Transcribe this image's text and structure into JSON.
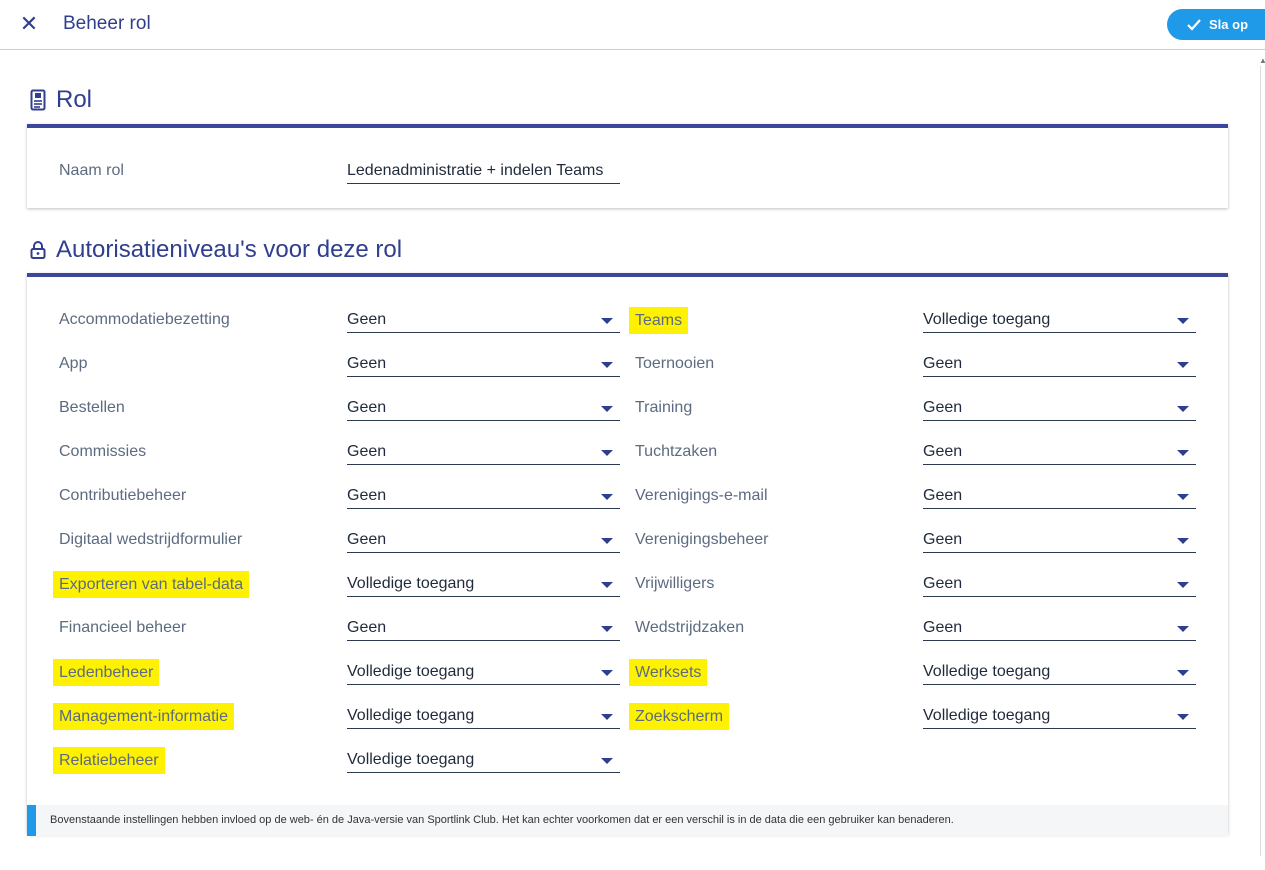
{
  "header": {
    "title": "Beheer rol",
    "save_label": "Sla op"
  },
  "role_section": {
    "heading": "Rol",
    "name_label": "Naam rol",
    "name_value": "Ledenadministratie + indelen Teams"
  },
  "auth_section": {
    "heading": "Autorisatieniveau's voor deze rol",
    "left": [
      {
        "label": "Accommodatiebezetting",
        "value": "Geen",
        "highlight": false
      },
      {
        "label": "App",
        "value": "Geen",
        "highlight": false
      },
      {
        "label": "Bestellen",
        "value": "Geen",
        "highlight": false
      },
      {
        "label": "Commissies",
        "value": "Geen",
        "highlight": false
      },
      {
        "label": "Contributiebeheer",
        "value": "Geen",
        "highlight": false
      },
      {
        "label": "Digitaal wedstrijdformulier",
        "value": "Geen",
        "highlight": false
      },
      {
        "label": "Exporteren van tabel-data",
        "value": "Volledige toegang",
        "highlight": true
      },
      {
        "label": "Financieel beheer",
        "value": "Geen",
        "highlight": false
      },
      {
        "label": "Ledenbeheer",
        "value": "Volledige toegang",
        "highlight": true
      },
      {
        "label": "Management-informatie",
        "value": "Volledige toegang",
        "highlight": true
      },
      {
        "label": "Relatiebeheer",
        "value": "Volledige toegang",
        "highlight": true
      }
    ],
    "right": [
      {
        "label": "Teams",
        "value": "Volledige toegang",
        "highlight": true
      },
      {
        "label": "Toernooien",
        "value": "Geen",
        "highlight": false
      },
      {
        "label": "Training",
        "value": "Geen",
        "highlight": false
      },
      {
        "label": "Tuchtzaken",
        "value": "Geen",
        "highlight": false
      },
      {
        "label": "Verenigings-e-mail",
        "value": "Geen",
        "highlight": false
      },
      {
        "label": "Verenigingsbeheer",
        "value": "Geen",
        "highlight": false
      },
      {
        "label": "Vrijwilligers",
        "value": "Geen",
        "highlight": false
      },
      {
        "label": "Wedstrijdzaken",
        "value": "Geen",
        "highlight": false
      },
      {
        "label": "Werksets",
        "value": "Volledige toegang",
        "highlight": true
      },
      {
        "label": "Zoekscherm",
        "value": "Volledige toegang",
        "highlight": true
      }
    ],
    "note": "Bovenstaande instellingen hebben invloed op de web- én de Java-versie van Sportlink Club. Het kan echter voorkomen dat er een verschil is in de data die een gebruiker kan benaderen."
  },
  "colors": {
    "accent": "#2f3e8f",
    "save": "#1e9ae8",
    "highlight": "#fff200"
  },
  "icons": {
    "close": "close-icon",
    "role": "id-card-icon",
    "auth": "lock-icon",
    "save": "check-icon",
    "dropdown": "caret-down-icon"
  }
}
